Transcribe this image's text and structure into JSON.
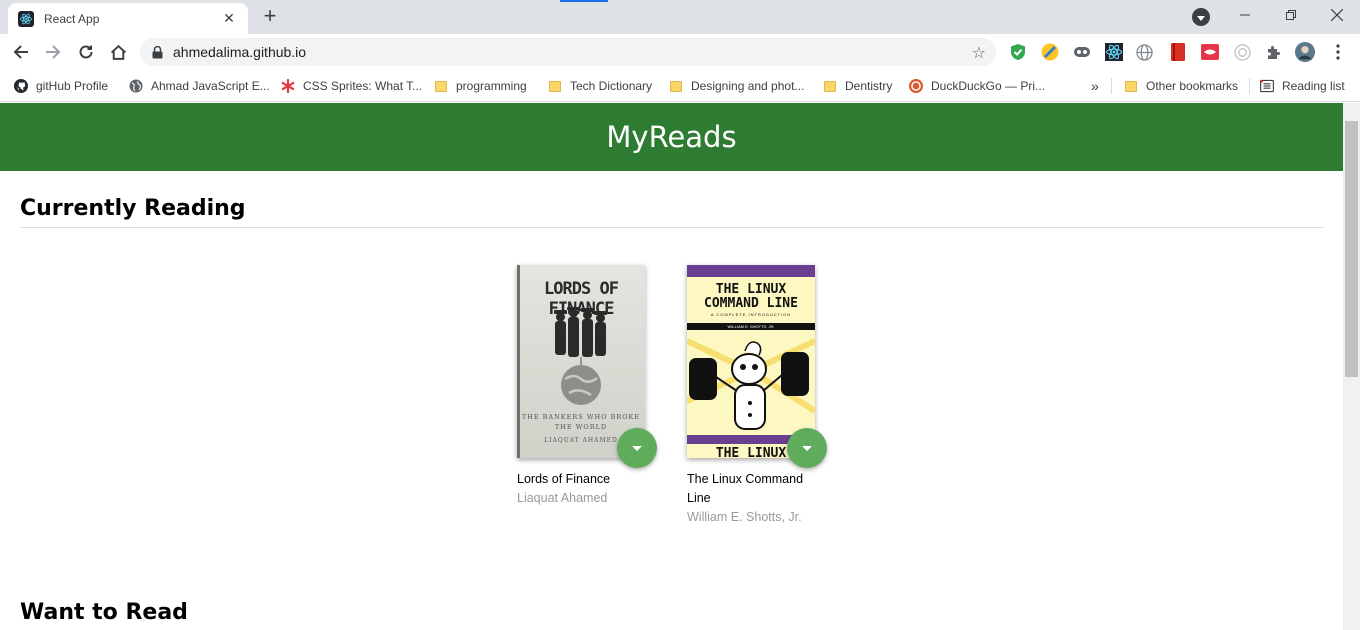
{
  "browser": {
    "tab_title": "React App",
    "url": "ahmedalima.github.io"
  },
  "bookmarks": [
    {
      "label": "gitHub Profile",
      "icon": "github-icon"
    },
    {
      "label": "Ahmad JavaScript E...",
      "icon": "globe-icon"
    },
    {
      "label": "CSS Sprites: What T...",
      "icon": "asterisk-icon"
    },
    {
      "label": "programming",
      "icon": "folder-icon"
    },
    {
      "label": "Tech Dictionary",
      "icon": "folder-icon"
    },
    {
      "label": "Designing and phot...",
      "icon": "folder-icon"
    },
    {
      "label": "Dentistry",
      "icon": "folder-icon"
    },
    {
      "label": "DuckDuckGo — Pri...",
      "icon": "duckduckgo-icon"
    }
  ],
  "bookmarks_overflow": "»",
  "other_bookmarks": "Other bookmarks",
  "reading_list": "Reading list",
  "app": {
    "title": "MyReads",
    "accent_color": "#2e7c31",
    "button_color": "#60ac5d"
  },
  "shelves": [
    {
      "title": "Currently Reading",
      "books": [
        {
          "title": "Lords of Finance",
          "author": "Liaquat Ahamed",
          "cover": {
            "heading": "LORDS OF FINANCE",
            "subtitle": "THE BANKERS WHO BROKE THE WORLD",
            "author": "LIAQUAT AHAMED"
          }
        },
        {
          "title": "The Linux Command Line",
          "author": "William E. Shotts, Jr.",
          "cover": {
            "heading": "THE LINUX COMMAND LINE",
            "subtitle": "A COMPLETE INTRODUCTION",
            "author": "WILLIAM E. SHOTTS, JR."
          }
        }
      ]
    },
    {
      "title": "Want to Read",
      "books": []
    }
  ]
}
